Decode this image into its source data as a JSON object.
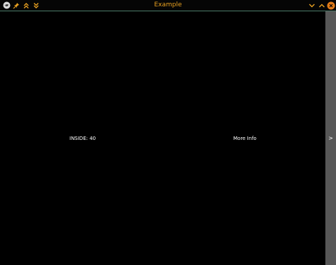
{
  "window": {
    "title": "Example"
  },
  "titlebar": {
    "left_icons": [
      "app-logo-icon",
      "pin-icon",
      "chevrons-up-icon",
      "chevrons-down-icon"
    ],
    "right_icons": [
      "chevron-down-icon",
      "chevron-up-icon",
      "close-icon"
    ],
    "accent_color": "#e8a020",
    "close_color": "#e07a18"
  },
  "content": {
    "inside_label": "INSIDE: 40",
    "more_info_label": "More Info"
  },
  "side_panel": {
    "toggle_label": ">"
  }
}
